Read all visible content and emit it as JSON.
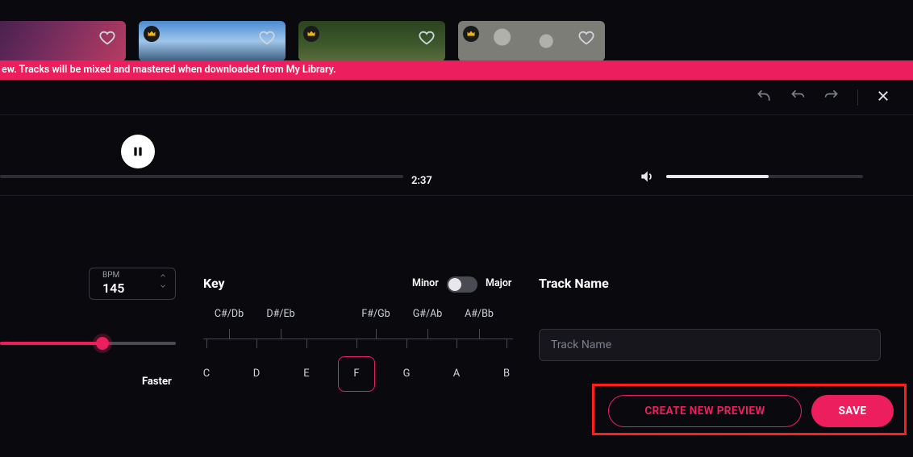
{
  "banner": {
    "text": "ew. Tracks will be mixed and mastered when downloaded from My Library."
  },
  "player": {
    "time": "2:37",
    "progress_pct": 0,
    "volume_pct": 52
  },
  "bpm": {
    "label": "BPM",
    "value": "145",
    "tempo_label": "Faster",
    "tempo_slider_pct": 58
  },
  "key": {
    "label": "Key",
    "minor_label": "Minor",
    "major_label": "Major",
    "mode": "Minor",
    "selected": "F",
    "sharps": [
      "C#/Db",
      "D#/Eb",
      "F#/Gb",
      "G#/Ab",
      "A#/Bb"
    ],
    "naturals": [
      "C",
      "D",
      "E",
      "F",
      "G",
      "A",
      "B"
    ]
  },
  "track": {
    "label": "Track Name",
    "placeholder": "Track Name",
    "value": ""
  },
  "buttons": {
    "create_preview": "CREATE NEW PREVIEW",
    "save": "SAVE"
  },
  "icons": {
    "crown": "crown-icon",
    "heart": "heart-icon",
    "undo": "undo-icon",
    "redo": "redo-icon",
    "reply": "reply-icon",
    "close": "close-icon",
    "pause": "pause-icon",
    "volume": "volume-icon",
    "chev_up": "chevron-up-icon",
    "chev_down": "chevron-down-icon"
  }
}
